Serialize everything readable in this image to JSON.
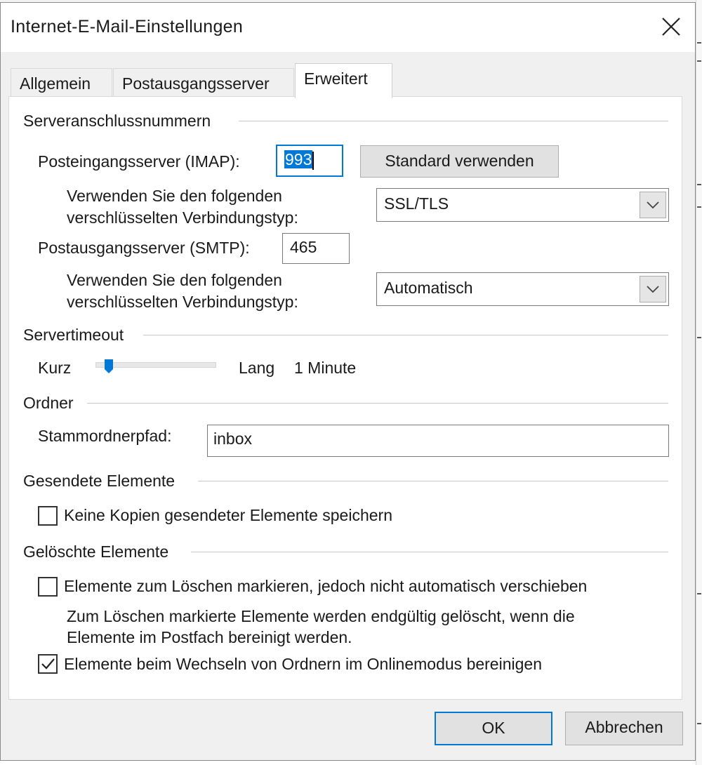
{
  "window": {
    "title": "Internet-E-Mail-Einstellungen",
    "close_icon": "close-icon"
  },
  "tabs": [
    {
      "label": "Allgemein",
      "active": false
    },
    {
      "label": "Postausgangsserver",
      "active": false
    },
    {
      "label": "Erweitert",
      "active": true
    }
  ],
  "server_ports": {
    "group_label": "Serveranschlussnummern",
    "incoming_label": "Posteingangsserver (IMAP):",
    "incoming_value": "993",
    "default_button": "Standard verwenden",
    "encryption_label_line1": "Verwenden Sie den folgenden",
    "encryption_label_line2": "verschlüsselten Verbindungstyp:",
    "incoming_encryption": "SSL/TLS",
    "outgoing_label": "Postausgangsserver (SMTP):",
    "outgoing_value": "465",
    "outgoing_encryption": "Automatisch"
  },
  "timeout": {
    "group_label": "Servertimeout",
    "short_label": "Kurz",
    "long_label": "Lang",
    "value_text": "1 Minute",
    "slider_fraction": 0.08
  },
  "folders": {
    "group_label": "Ordner",
    "root_label": "Stammordnerpfad:",
    "root_value": "inbox"
  },
  "sent_items": {
    "group_label": "Gesendete Elemente",
    "no_copies_label": "Keine Kopien gesendeter Elemente speichern",
    "no_copies_checked": false
  },
  "deleted_items": {
    "group_label": "Gelöschte Elemente",
    "mark_label": "Elemente zum Löschen markieren, jedoch nicht automatisch verschieben",
    "mark_checked": false,
    "note_line1": "Zum Löschen markierte Elemente werden endgültig gelöscht, wenn die",
    "note_line2": "Elemente im Postfach bereinigt werden.",
    "purge_label": "Elemente beim Wechseln von Ordnern im Onlinemodus bereinigen",
    "purge_checked": true
  },
  "footer": {
    "ok": "OK",
    "cancel": "Abbrechen"
  },
  "colors": {
    "accent": "#0078d7",
    "dialog_bg": "#f0f0f0",
    "panel_bg": "#ffffff"
  }
}
